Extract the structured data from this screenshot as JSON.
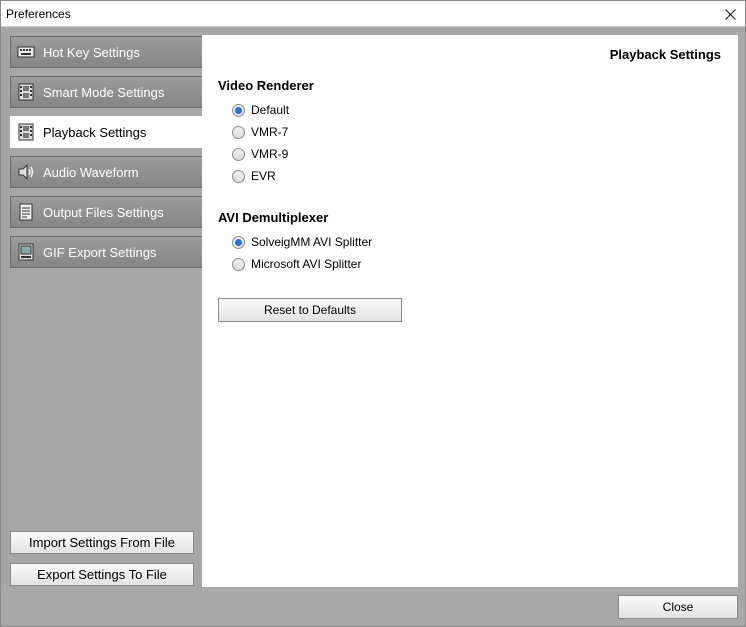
{
  "window": {
    "title": "Preferences"
  },
  "sidebar": {
    "items": [
      {
        "label": "Hot Key Settings",
        "icon": "keyboard-icon",
        "active": false
      },
      {
        "label": "Smart Mode Settings",
        "icon": "film-icon",
        "active": false
      },
      {
        "label": "Playback Settings",
        "icon": "film-icon",
        "active": true
      },
      {
        "label": "Audio Waveform",
        "icon": "speaker-icon",
        "active": false
      },
      {
        "label": "Output Files Settings",
        "icon": "document-icon",
        "active": false
      },
      {
        "label": "GIF Export Settings",
        "icon": "gif-icon",
        "active": false
      }
    ],
    "import_label": "Import Settings From File",
    "export_label": "Export Settings To File"
  },
  "content": {
    "title": "Playback Settings",
    "video_renderer": {
      "label": "Video Renderer",
      "options": [
        "Default",
        "VMR-7",
        "VMR-9",
        "EVR"
      ],
      "selected": "Default"
    },
    "avi_demux": {
      "label": "AVI Demultiplexer",
      "options": [
        "SolveigMM AVI Splitter",
        "Microsoft AVI Splitter"
      ],
      "selected": "SolveigMM AVI Splitter"
    },
    "reset_label": "Reset to Defaults"
  },
  "footer": {
    "close_label": "Close"
  },
  "colors": {
    "accent": "#2f6fd0",
    "sidebar_bg": "#a6a6a6"
  }
}
